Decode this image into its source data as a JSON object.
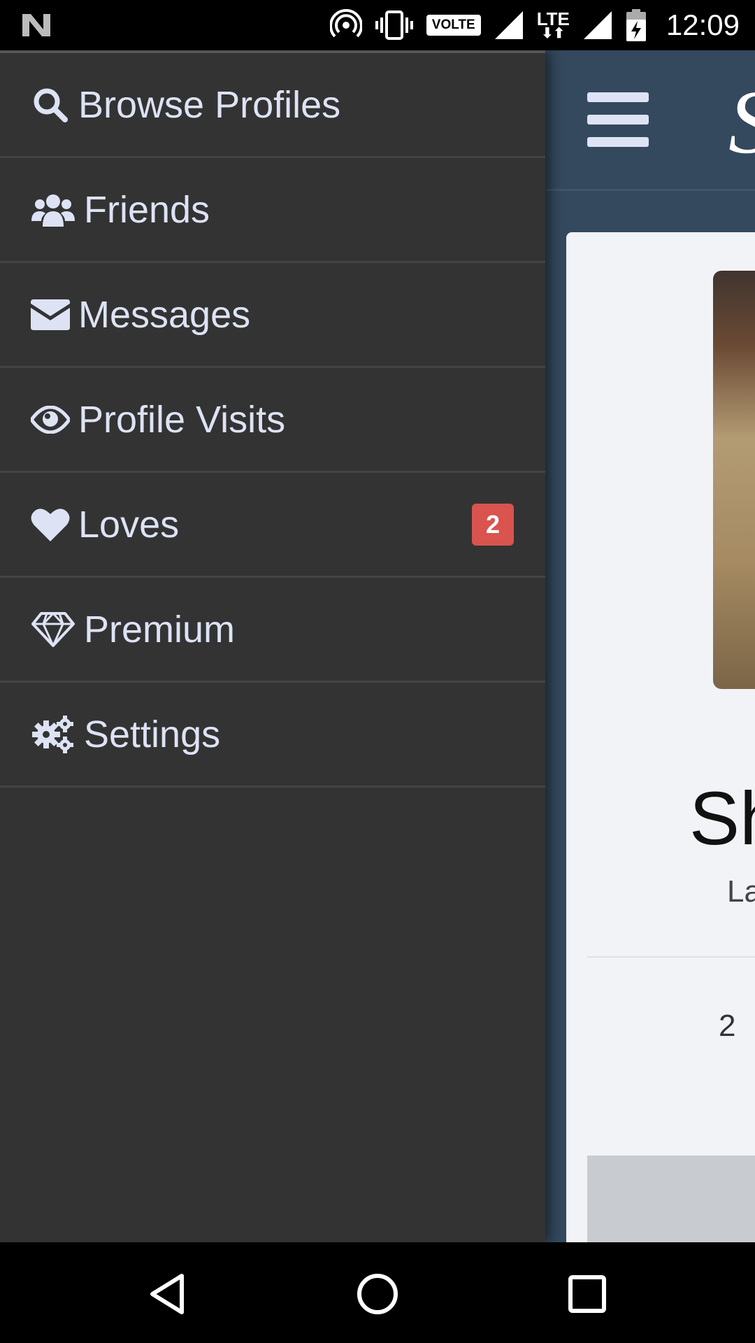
{
  "status_bar": {
    "time": "12:09",
    "volte_label": "VOLTE",
    "lte_label": "LTE",
    "icons": [
      "notification-n-icon",
      "hotspot-icon",
      "vibrate-icon",
      "volte-icon",
      "signal-icon",
      "lte-icon",
      "signal-icon",
      "battery-charging-icon"
    ]
  },
  "drawer": {
    "items": [
      {
        "label": "Browse Profiles",
        "icon": "search-icon"
      },
      {
        "label": "Friends",
        "icon": "users-icon"
      },
      {
        "label": "Messages",
        "icon": "envelope-icon"
      },
      {
        "label": "Profile Visits",
        "icon": "eye-icon"
      },
      {
        "label": "Loves",
        "icon": "heart-icon",
        "badge": "2"
      },
      {
        "label": "Premium",
        "icon": "diamond-icon"
      },
      {
        "label": "Settings",
        "icon": "gears-icon"
      }
    ]
  },
  "app": {
    "brand_glyph": "S",
    "profile_name": "Sh",
    "profile_sub": "La",
    "stat": "2"
  },
  "colors": {
    "drawer_bg": "#333333",
    "menu_text": "#dde3f5",
    "badge": "#d9534f",
    "app_bg": "#34495e",
    "card_bg": "#f2f3f7"
  },
  "navbar": {
    "buttons": [
      "back-icon",
      "home-icon",
      "recents-icon"
    ]
  }
}
